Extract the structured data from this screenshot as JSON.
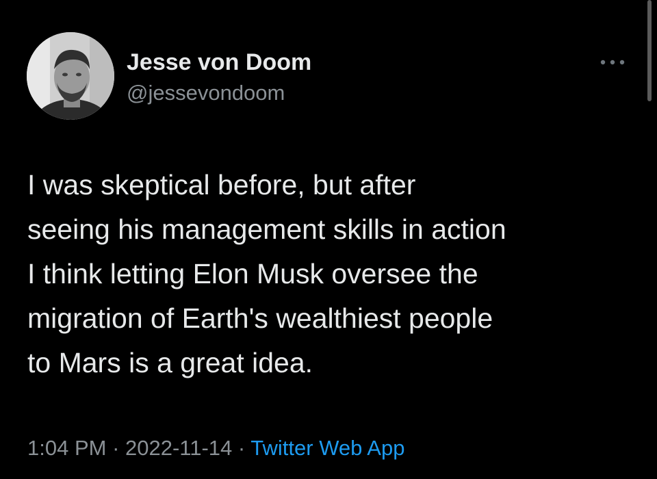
{
  "author": {
    "name": "Jesse von Doom",
    "handle": "@jessevondoom"
  },
  "tweet": {
    "lines": [
      "I was skeptical before, but after",
      "seeing his management skills in action",
      "I think letting Elon Musk oversee the",
      "migration of Earth's wealthiest people",
      "to Mars is a great idea."
    ]
  },
  "meta": {
    "time": "1:04 PM",
    "separator": " · ",
    "date": "2022-11-14",
    "source": "Twitter Web App"
  },
  "icons": {
    "more": "more-horizontal-icon",
    "avatar": "profile-photo"
  },
  "colors": {
    "background": "#000000",
    "text_primary": "#e7e9ea",
    "text_secondary": "#8b9196",
    "link": "#1d9bf0"
  }
}
